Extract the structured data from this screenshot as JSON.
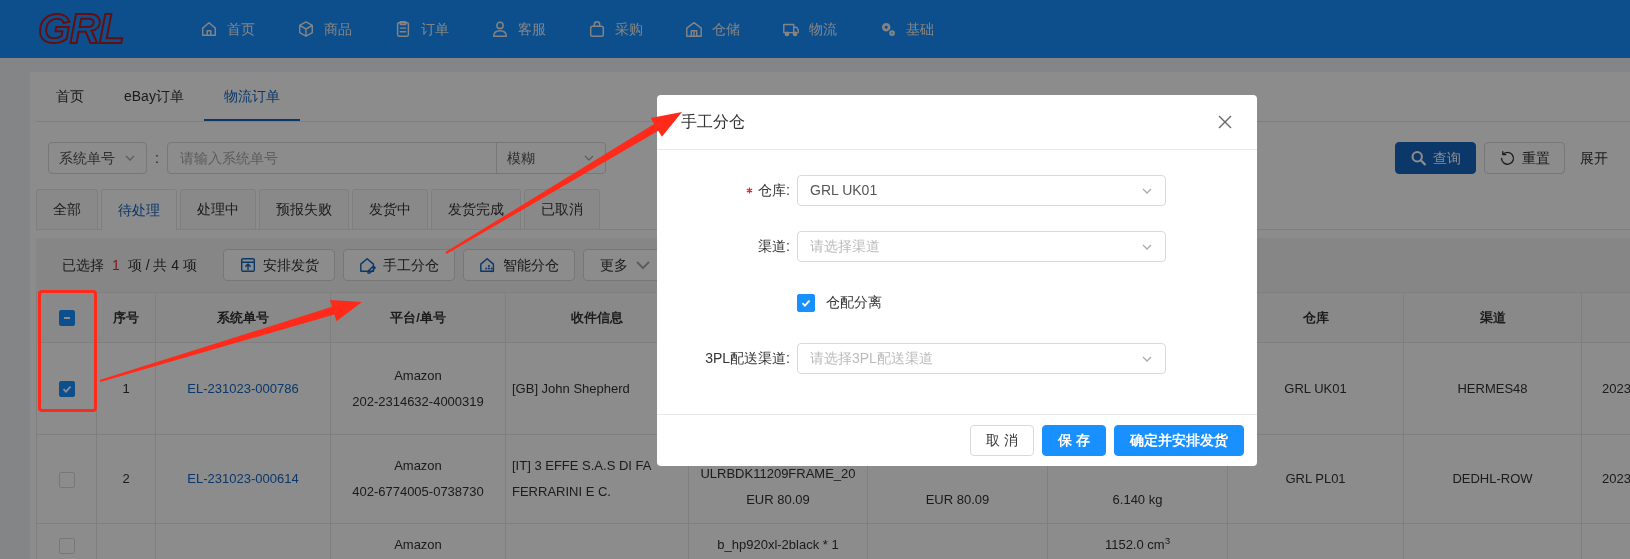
{
  "header": {
    "logo": "GRL",
    "nav": [
      {
        "label": "首页"
      },
      {
        "label": "商品"
      },
      {
        "label": "订单"
      },
      {
        "label": "客服"
      },
      {
        "label": "采购"
      },
      {
        "label": "仓储"
      },
      {
        "label": "物流"
      },
      {
        "label": "基础"
      }
    ]
  },
  "page_tabs": [
    {
      "label": "首页",
      "selected": false
    },
    {
      "label": "eBay订单",
      "selected": false
    },
    {
      "label": "物流订单",
      "selected": true
    }
  ],
  "search": {
    "field_select": "系统单号",
    "separator": ":",
    "placeholder": "请输入系统单号",
    "match_mode": "模糊",
    "buttons": [
      {
        "kind": "primary",
        "label": "查询"
      },
      {
        "kind": "default",
        "label": "重置"
      }
    ],
    "expand_link": "展开"
  },
  "status_tabs": [
    {
      "label": "全部",
      "selected": false
    },
    {
      "label": "待处理",
      "selected": true
    },
    {
      "label": "处理中",
      "selected": false
    },
    {
      "label": "预报失败",
      "selected": false
    },
    {
      "label": "发货中",
      "selected": false
    },
    {
      "label": "发货完成",
      "selected": false
    },
    {
      "label": "已取消",
      "selected": false
    }
  ],
  "toolbar": {
    "selected_prefix": "已选择",
    "selected_count": "1",
    "selected_suffix": "项 / 共 4 项",
    "actions": [
      {
        "kind": "button",
        "label": "安排发货"
      },
      {
        "kind": "button",
        "label": "手工分仓"
      },
      {
        "kind": "button",
        "label": "智能分仓"
      },
      {
        "kind": "dropdown",
        "label": "更多"
      }
    ]
  },
  "table": {
    "header_checkbox": {
      "indeterminate": true
    },
    "columns": [
      "序号",
      "系统单号",
      "平台/单号",
      "收件信息",
      null,
      null,
      null,
      "仓库",
      "渠道",
      null
    ],
    "rows": [
      {
        "selected": true,
        "cells": [
          [
            "1"
          ],
          [
            "EL-231023-000786"
          ],
          [
            "Amazon",
            "202-2314632-4000319"
          ],
          [
            "[GB] John Shepherd"
          ],
          null,
          null,
          null,
          [
            "GRL UK01"
          ],
          [
            "HERMES48"
          ],
          [
            "2023"
          ]
        ]
      },
      {
        "selected": false,
        "cells": [
          [
            "2"
          ],
          [
            "EL-231023-000614"
          ],
          [
            "Amazon",
            "402-6774005-0738730"
          ],
          [
            "[IT] 3 EFFE S.A.S DI FA",
            "FERRARINI E C."
          ],
          [
            "ULRBDK11209FRAME_20",
            "EUR 80.09"
          ],
          [
            "EUR 80.09"
          ],
          [
            "6.140 kg"
          ],
          [
            "GRL PL01"
          ],
          [
            "DEDHL-ROW"
          ],
          [
            "2023"
          ]
        ]
      },
      {
        "selected": false,
        "cells": [
          null,
          null,
          [
            "Amazon"
          ],
          null,
          [
            "b_hp920xl-2black * 1"
          ],
          null,
          [
            "1152.0 cm$^{3}$"
          ],
          null,
          null,
          null
        ]
      }
    ]
  },
  "dialog": {
    "title": "手工分仓",
    "fields": [
      {
        "kind": "select",
        "label": "仓库:",
        "required": true,
        "value": "GRL UK01"
      },
      {
        "kind": "select",
        "label": "渠道:",
        "required": false,
        "placeholder": "请选择渠道"
      },
      {
        "kind": "checkbox",
        "label": "仓配分离",
        "checked": true
      },
      {
        "kind": "select",
        "label": "3PL配送渠道:",
        "required": false,
        "placeholder": "请选择3PL配送渠道"
      }
    ],
    "buttons": [
      {
        "kind": "default",
        "label": "取 消"
      },
      {
        "kind": "primary",
        "label": "保 存"
      },
      {
        "kind": "primary",
        "label": "确定并安排发货"
      }
    ]
  }
}
